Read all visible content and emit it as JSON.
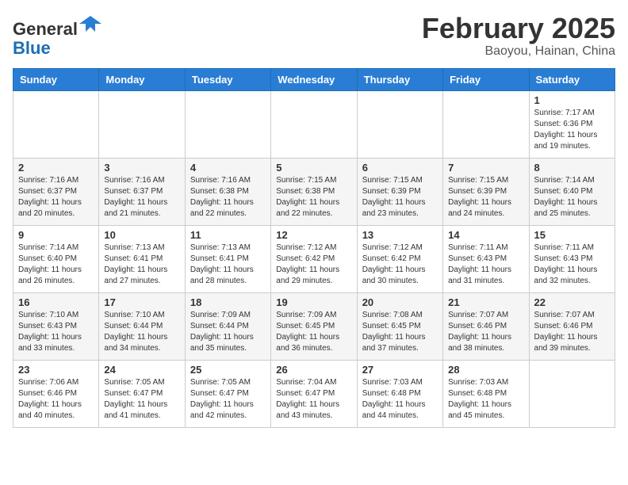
{
  "header": {
    "logo_line1": "General",
    "logo_line2": "Blue",
    "month_title": "February 2025",
    "location": "Baoyou, Hainan, China"
  },
  "days_of_week": [
    "Sunday",
    "Monday",
    "Tuesday",
    "Wednesday",
    "Thursday",
    "Friday",
    "Saturday"
  ],
  "weeks": [
    [
      {
        "day": "",
        "info": ""
      },
      {
        "day": "",
        "info": ""
      },
      {
        "day": "",
        "info": ""
      },
      {
        "day": "",
        "info": ""
      },
      {
        "day": "",
        "info": ""
      },
      {
        "day": "",
        "info": ""
      },
      {
        "day": "1",
        "info": "Sunrise: 7:17 AM\nSunset: 6:36 PM\nDaylight: 11 hours and 19 minutes."
      }
    ],
    [
      {
        "day": "2",
        "info": "Sunrise: 7:16 AM\nSunset: 6:37 PM\nDaylight: 11 hours and 20 minutes."
      },
      {
        "day": "3",
        "info": "Sunrise: 7:16 AM\nSunset: 6:37 PM\nDaylight: 11 hours and 21 minutes."
      },
      {
        "day": "4",
        "info": "Sunrise: 7:16 AM\nSunset: 6:38 PM\nDaylight: 11 hours and 22 minutes."
      },
      {
        "day": "5",
        "info": "Sunrise: 7:15 AM\nSunset: 6:38 PM\nDaylight: 11 hours and 22 minutes."
      },
      {
        "day": "6",
        "info": "Sunrise: 7:15 AM\nSunset: 6:39 PM\nDaylight: 11 hours and 23 minutes."
      },
      {
        "day": "7",
        "info": "Sunrise: 7:15 AM\nSunset: 6:39 PM\nDaylight: 11 hours and 24 minutes."
      },
      {
        "day": "8",
        "info": "Sunrise: 7:14 AM\nSunset: 6:40 PM\nDaylight: 11 hours and 25 minutes."
      }
    ],
    [
      {
        "day": "9",
        "info": "Sunrise: 7:14 AM\nSunset: 6:40 PM\nDaylight: 11 hours and 26 minutes."
      },
      {
        "day": "10",
        "info": "Sunrise: 7:13 AM\nSunset: 6:41 PM\nDaylight: 11 hours and 27 minutes."
      },
      {
        "day": "11",
        "info": "Sunrise: 7:13 AM\nSunset: 6:41 PM\nDaylight: 11 hours and 28 minutes."
      },
      {
        "day": "12",
        "info": "Sunrise: 7:12 AM\nSunset: 6:42 PM\nDaylight: 11 hours and 29 minutes."
      },
      {
        "day": "13",
        "info": "Sunrise: 7:12 AM\nSunset: 6:42 PM\nDaylight: 11 hours and 30 minutes."
      },
      {
        "day": "14",
        "info": "Sunrise: 7:11 AM\nSunset: 6:43 PM\nDaylight: 11 hours and 31 minutes."
      },
      {
        "day": "15",
        "info": "Sunrise: 7:11 AM\nSunset: 6:43 PM\nDaylight: 11 hours and 32 minutes."
      }
    ],
    [
      {
        "day": "16",
        "info": "Sunrise: 7:10 AM\nSunset: 6:43 PM\nDaylight: 11 hours and 33 minutes."
      },
      {
        "day": "17",
        "info": "Sunrise: 7:10 AM\nSunset: 6:44 PM\nDaylight: 11 hours and 34 minutes."
      },
      {
        "day": "18",
        "info": "Sunrise: 7:09 AM\nSunset: 6:44 PM\nDaylight: 11 hours and 35 minutes."
      },
      {
        "day": "19",
        "info": "Sunrise: 7:09 AM\nSunset: 6:45 PM\nDaylight: 11 hours and 36 minutes."
      },
      {
        "day": "20",
        "info": "Sunrise: 7:08 AM\nSunset: 6:45 PM\nDaylight: 11 hours and 37 minutes."
      },
      {
        "day": "21",
        "info": "Sunrise: 7:07 AM\nSunset: 6:46 PM\nDaylight: 11 hours and 38 minutes."
      },
      {
        "day": "22",
        "info": "Sunrise: 7:07 AM\nSunset: 6:46 PM\nDaylight: 11 hours and 39 minutes."
      }
    ],
    [
      {
        "day": "23",
        "info": "Sunrise: 7:06 AM\nSunset: 6:46 PM\nDaylight: 11 hours and 40 minutes."
      },
      {
        "day": "24",
        "info": "Sunrise: 7:05 AM\nSunset: 6:47 PM\nDaylight: 11 hours and 41 minutes."
      },
      {
        "day": "25",
        "info": "Sunrise: 7:05 AM\nSunset: 6:47 PM\nDaylight: 11 hours and 42 minutes."
      },
      {
        "day": "26",
        "info": "Sunrise: 7:04 AM\nSunset: 6:47 PM\nDaylight: 11 hours and 43 minutes."
      },
      {
        "day": "27",
        "info": "Sunrise: 7:03 AM\nSunset: 6:48 PM\nDaylight: 11 hours and 44 minutes."
      },
      {
        "day": "28",
        "info": "Sunrise: 7:03 AM\nSunset: 6:48 PM\nDaylight: 11 hours and 45 minutes."
      },
      {
        "day": "",
        "info": ""
      }
    ]
  ]
}
